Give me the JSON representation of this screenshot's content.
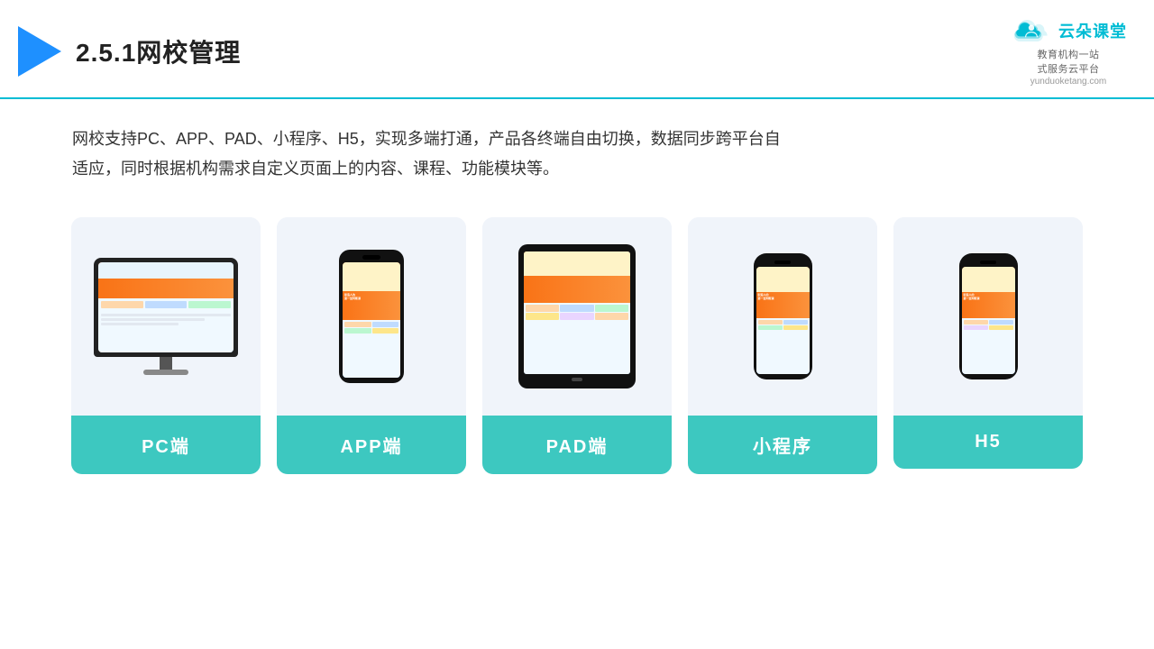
{
  "header": {
    "title": "2.5.1网校管理",
    "brand_name": "云朵课堂",
    "brand_sub": "教育机构一站\n式服务云平台",
    "brand_url": "yunduoketang.com"
  },
  "description": {
    "text": "网校支持PC、APP、PAD、小程序、H5，实现多端打通，产品各终端自由切换，数据同步跨平台自适应，同时根据机构需求自定义页面上的内容、课程、功能模块等。"
  },
  "cards": [
    {
      "id": "pc",
      "label": "PC端"
    },
    {
      "id": "app",
      "label": "APP端"
    },
    {
      "id": "pad",
      "label": "PAD端"
    },
    {
      "id": "miniapp",
      "label": "小程序"
    },
    {
      "id": "h5",
      "label": "H5"
    }
  ]
}
